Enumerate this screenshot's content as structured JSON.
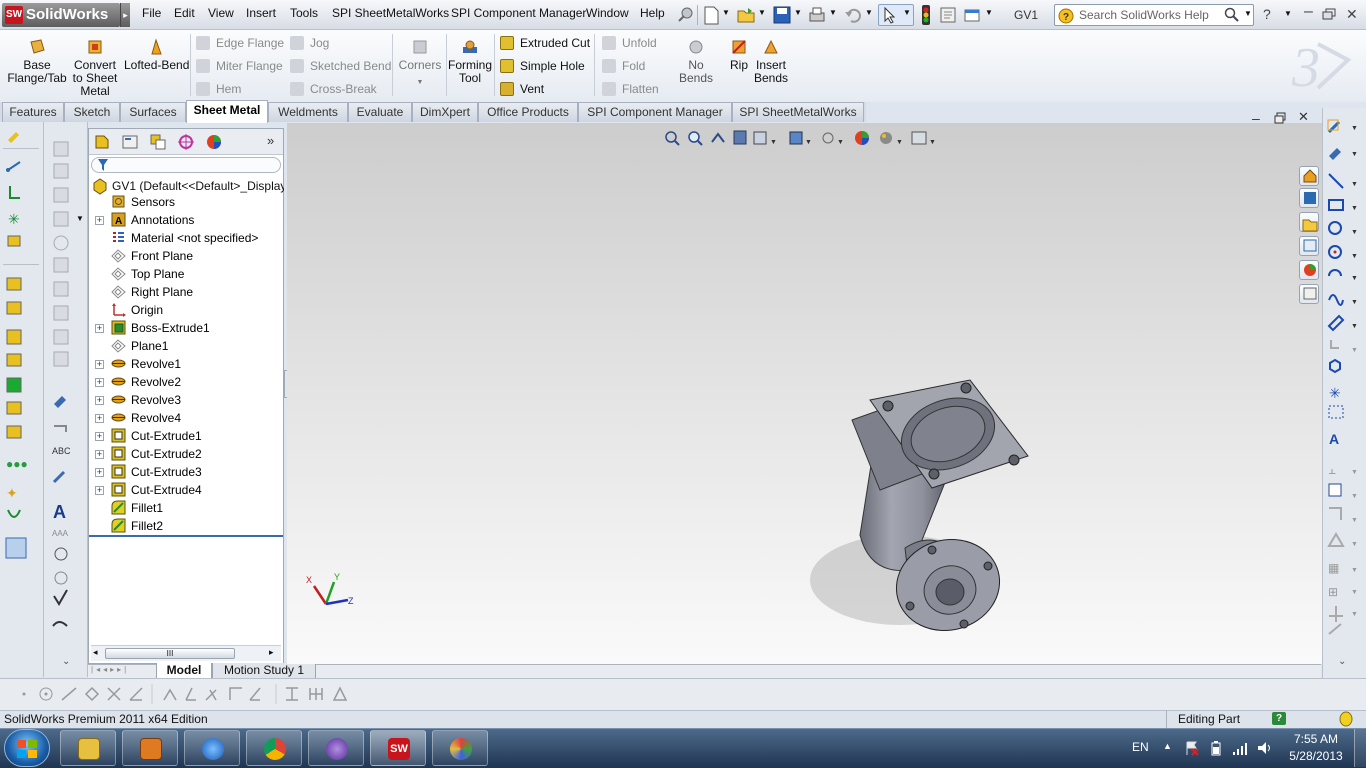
{
  "app": {
    "logo": "SolidWorks",
    "logo_mark": "SW"
  },
  "menu": [
    "File",
    "Edit",
    "View",
    "Insert",
    "Tools",
    "SPI SheetMetalWorks",
    "SPI Component Manager",
    "Window",
    "Help"
  ],
  "document_name": "GV1",
  "search": {
    "placeholder": "Search SolidWorks Help"
  },
  "command_manager": {
    "big_buttons": [
      "Base\nFlange/Tab",
      "Convert\nto Sheet\nMetal",
      "Lofted-Bend"
    ],
    "col1": [
      "Edge Flange",
      "Miter Flange",
      "Hem"
    ],
    "col2": [
      "Jog",
      "Sketched Bend",
      "Cross-Break"
    ],
    "corners": "Corners",
    "forming_tool": "Forming\nTool",
    "col3": [
      "Extruded Cut",
      "Simple Hole",
      "Vent"
    ],
    "col4": [
      "Unfold",
      "Fold",
      "Flatten"
    ],
    "no_bends": "No Bends",
    "rip": "Rip",
    "insert_bends": "Insert\nBends"
  },
  "tabs": [
    "Features",
    "Sketch",
    "Surfaces",
    "Sheet Metal",
    "Weldments",
    "Evaluate",
    "DimXpert",
    "Office Products",
    "SPI Component Manager",
    "SPI SheetMetalWorks"
  ],
  "active_tab": "Sheet Metal",
  "feature_tree": {
    "root": "GV1  (Default<<Default>_Display",
    "items": [
      {
        "label": "Sensors",
        "expandable": false,
        "icon": "sensor-icon",
        "color": "#e0b030"
      },
      {
        "label": "Annotations",
        "expandable": true,
        "icon": "annotation-icon",
        "color": "#d8a020"
      },
      {
        "label": "Material <not specified>",
        "expandable": false,
        "icon": "material-icon",
        "color": "#3060c0"
      },
      {
        "label": "Front Plane",
        "expandable": false,
        "icon": "plane-icon",
        "color": "#888888"
      },
      {
        "label": "Top Plane",
        "expandable": false,
        "icon": "plane-icon",
        "color": "#888888"
      },
      {
        "label": "Right Plane",
        "expandable": false,
        "icon": "plane-icon",
        "color": "#888888"
      },
      {
        "label": "Origin",
        "expandable": false,
        "icon": "origin-icon",
        "color": "#c03030"
      },
      {
        "label": "Boss-Extrude1",
        "expandable": true,
        "icon": "extrude-icon",
        "color": "#d8c020"
      },
      {
        "label": "Plane1",
        "expandable": false,
        "icon": "plane-icon",
        "color": "#888888"
      },
      {
        "label": "Revolve1",
        "expandable": true,
        "icon": "revolve-icon",
        "color": "#e0a020"
      },
      {
        "label": "Revolve2",
        "expandable": true,
        "icon": "revolve-icon",
        "color": "#e0a020"
      },
      {
        "label": "Revolve3",
        "expandable": true,
        "icon": "revolve-icon",
        "color": "#e0a020"
      },
      {
        "label": "Revolve4",
        "expandable": true,
        "icon": "revolve-icon",
        "color": "#e0a020"
      },
      {
        "label": "Cut-Extrude1",
        "expandable": true,
        "icon": "cut-extrude-icon",
        "color": "#d8c020"
      },
      {
        "label": "Cut-Extrude2",
        "expandable": true,
        "icon": "cut-extrude-icon",
        "color": "#d8c020"
      },
      {
        "label": "Cut-Extrude3",
        "expandable": true,
        "icon": "cut-extrude-icon",
        "color": "#d8c020"
      },
      {
        "label": "Cut-Extrude4",
        "expandable": true,
        "icon": "cut-extrude-icon",
        "color": "#d8c020"
      },
      {
        "label": "Fillet1",
        "expandable": false,
        "icon": "fillet-icon",
        "color": "#e0d020"
      },
      {
        "label": "Fillet2",
        "expandable": false,
        "icon": "fillet-icon",
        "color": "#e0d020"
      }
    ],
    "scroll_glyph": "III"
  },
  "bottom_tabs": [
    "Model",
    "Motion Study 1"
  ],
  "triad": {
    "x": "X",
    "y": "Y",
    "z": "Z"
  },
  "status": {
    "edition": "SolidWorks Premium 2011 x64 Edition",
    "mode": "Editing Part"
  },
  "taskbar": {
    "apps": [
      "explorer-icon",
      "media-player-icon",
      "internet-explorer-icon",
      "chrome-icon",
      "media-app-icon",
      "solidworks-icon",
      "paint-icon"
    ],
    "language": "EN",
    "time": "7:55 AM",
    "date": "5/28/2013"
  },
  "colors": {
    "part_body": "#8f929c",
    "accent": "#1c58a8",
    "sw_red": "#c8141c"
  }
}
